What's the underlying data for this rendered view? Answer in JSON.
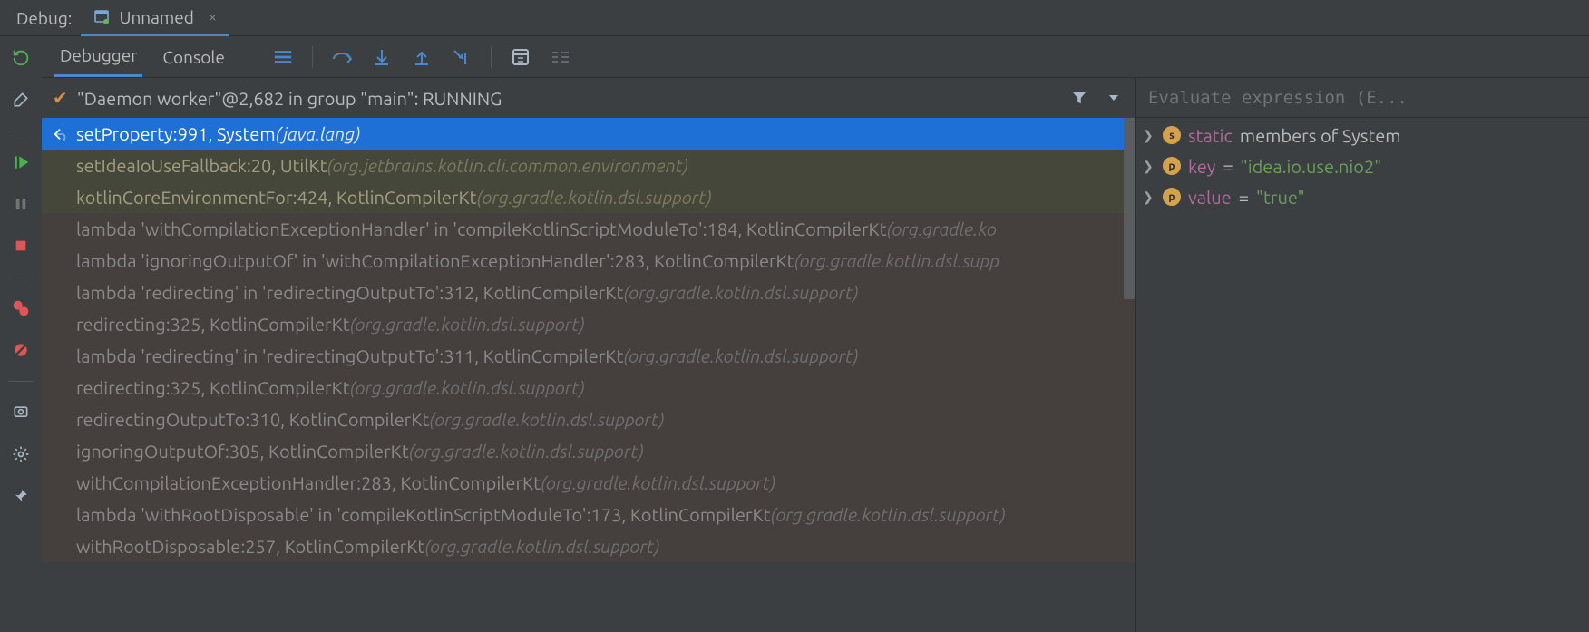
{
  "title_label": "Debug:",
  "config_tab": {
    "name": "Unnamed"
  },
  "tabs": {
    "debugger": "Debugger",
    "console": "Console"
  },
  "thread_status": "\"Daemon worker\"@2,682 in group \"main\": RUNNING",
  "frames": [
    {
      "kind": "sel",
      "call": "setProperty:991, System ",
      "pkg": "(java.lang)"
    },
    {
      "kind": "lib2",
      "call": "setIdeaIoUseFallback:20, UtilKt ",
      "pkg": "(org.jetbrains.kotlin.cli.common.environment)"
    },
    {
      "kind": "lib2",
      "call": "kotlinCoreEnvironmentFor:424, KotlinCompilerKt ",
      "pkg": "(org.gradle.kotlin.dsl.support)"
    },
    {
      "kind": "lib",
      "call": "lambda 'withCompilationExceptionHandler' in 'compileKotlinScriptModuleTo':184, KotlinCompilerKt ",
      "pkg": "(org.gradle.ko"
    },
    {
      "kind": "lib",
      "call": "lambda 'ignoringOutputOf' in 'withCompilationExceptionHandler':283, KotlinCompilerKt ",
      "pkg": "(org.gradle.kotlin.dsl.supp"
    },
    {
      "kind": "lib",
      "call": "lambda 'redirecting' in 'redirectingOutputTo':312, KotlinCompilerKt ",
      "pkg": "(org.gradle.kotlin.dsl.support)"
    },
    {
      "kind": "lib",
      "call": "redirecting:325, KotlinCompilerKt ",
      "pkg": "(org.gradle.kotlin.dsl.support)"
    },
    {
      "kind": "lib",
      "call": "lambda 'redirecting' in 'redirectingOutputTo':311, KotlinCompilerKt ",
      "pkg": "(org.gradle.kotlin.dsl.support)"
    },
    {
      "kind": "lib",
      "call": "redirecting:325, KotlinCompilerKt ",
      "pkg": "(org.gradle.kotlin.dsl.support)"
    },
    {
      "kind": "lib",
      "call": "redirectingOutputTo:310, KotlinCompilerKt ",
      "pkg": "(org.gradle.kotlin.dsl.support)"
    },
    {
      "kind": "lib",
      "call": "ignoringOutputOf:305, KotlinCompilerKt ",
      "pkg": "(org.gradle.kotlin.dsl.support)"
    },
    {
      "kind": "lib",
      "call": "withCompilationExceptionHandler:283, KotlinCompilerKt ",
      "pkg": "(org.gradle.kotlin.dsl.support)"
    },
    {
      "kind": "lib",
      "call": "lambda 'withRootDisposable' in 'compileKotlinScriptModuleTo':173, KotlinCompilerKt ",
      "pkg": "(org.gradle.kotlin.dsl.support)"
    },
    {
      "kind": "lib",
      "call": "withRootDisposable:257, KotlinCompilerKt ",
      "pkg": "(org.gradle.kotlin.dsl.support)"
    }
  ],
  "eval_placeholder": "Evaluate expression (E...",
  "vars": [
    {
      "badge": "s",
      "name_html": "static",
      "tail": " members of System"
    },
    {
      "badge": "p",
      "name_html": "key",
      "eq": " = ",
      "str": "\"idea.io.use.nio2\""
    },
    {
      "badge": "p",
      "name_html": "value",
      "eq": " = ",
      "str": "\"true\""
    }
  ]
}
